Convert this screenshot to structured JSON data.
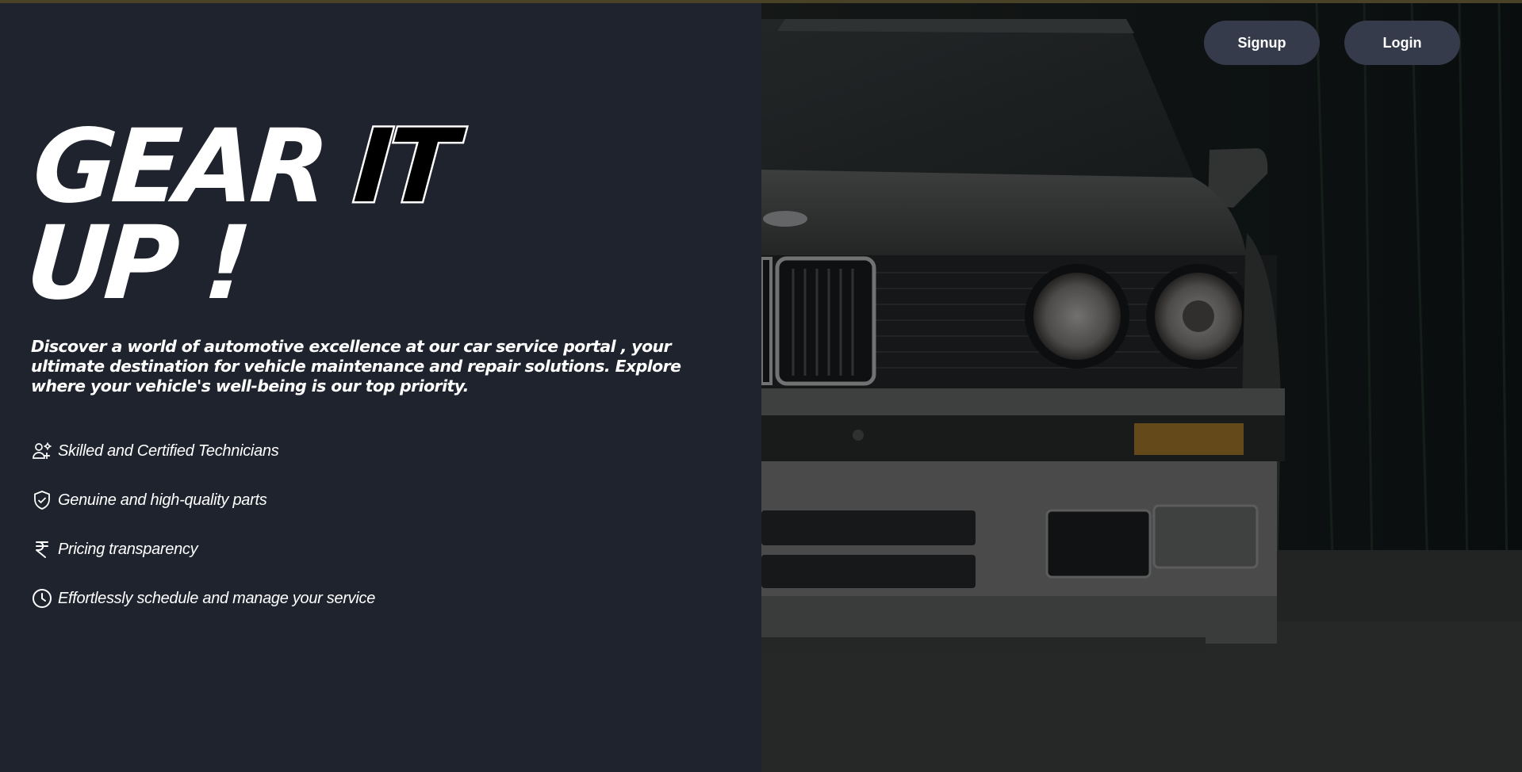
{
  "hero": {
    "title_word1": "GEAR",
    "title_word2": "IT",
    "title_word3": "UP !",
    "tagline": "Discover a world of automotive excellence at our car service portal , your ultimate destination for vehicle maintenance and repair solutions. Explore where your vehicle's well-being is our top priority."
  },
  "features": [
    {
      "icon": "technicians-icon",
      "label": "Skilled and Certified Technicians"
    },
    {
      "icon": "shield-check-icon",
      "label": "Genuine and high-quality parts"
    },
    {
      "icon": "rupee-icon",
      "label": "Pricing transparency"
    },
    {
      "icon": "clock-icon",
      "label": "Effortlessly schedule and manage your service"
    }
  ],
  "nav": {
    "signup_label": "Signup",
    "login_label": "Login"
  },
  "colors": {
    "background": "#1f232d",
    "button": "#353b4a",
    "text": "#ffffff"
  }
}
